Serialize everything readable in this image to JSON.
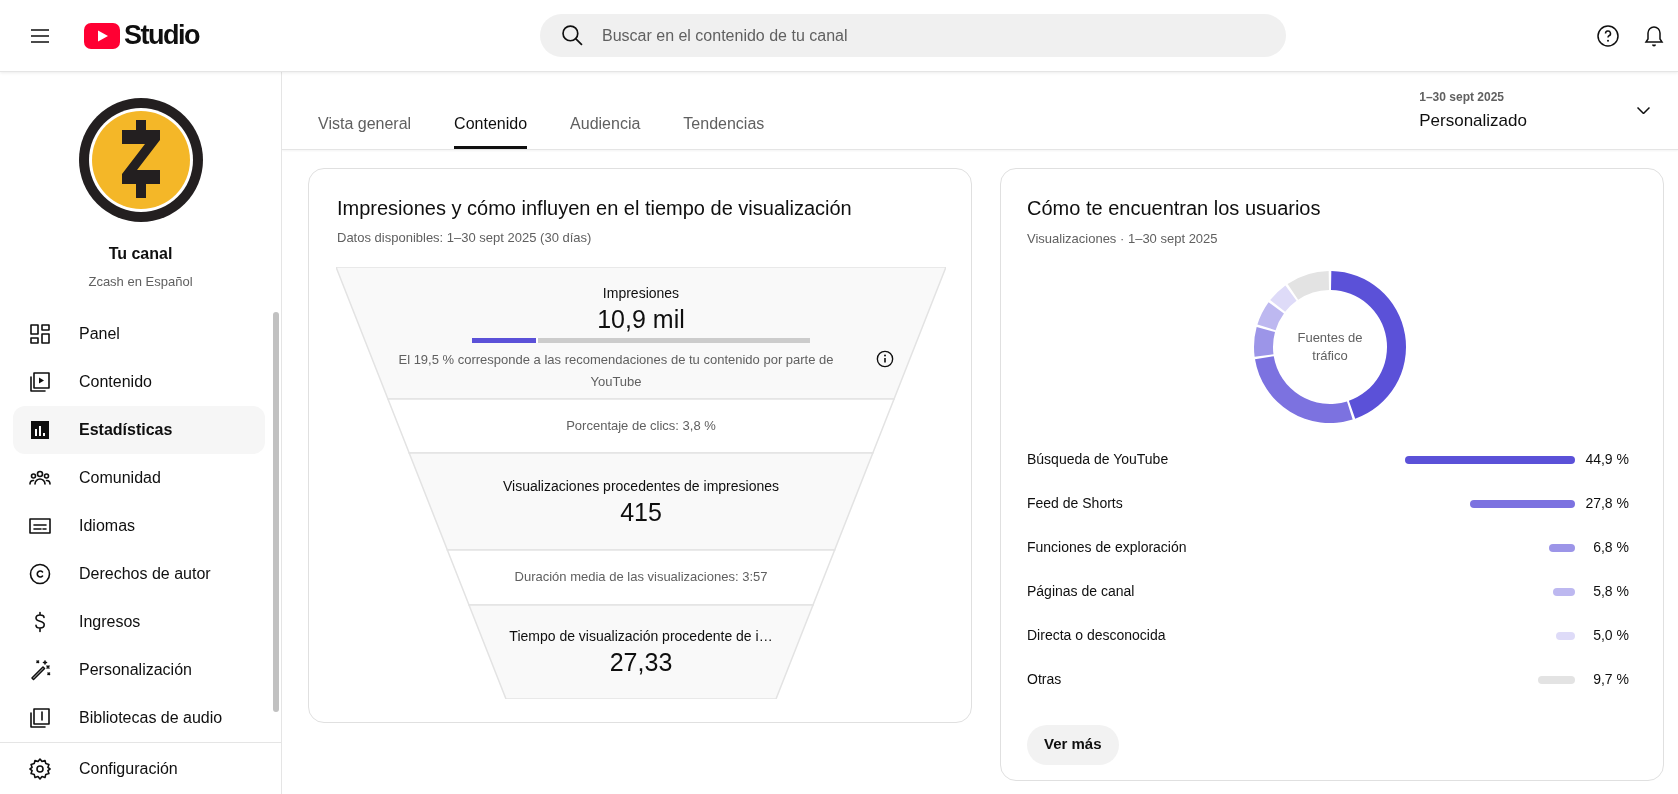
{
  "header": {
    "logo_text": "Studio",
    "search": {
      "placeholder": "Buscar en el contenido de tu canal"
    }
  },
  "channel": {
    "title": "Tu canal",
    "name": "Zcash en Español"
  },
  "sidebar": {
    "items": [
      {
        "label": "Panel",
        "selected": false
      },
      {
        "label": "Contenido",
        "selected": false
      },
      {
        "label": "Estadísticas",
        "selected": true
      },
      {
        "label": "Comunidad",
        "selected": false
      },
      {
        "label": "Idiomas",
        "selected": false
      },
      {
        "label": "Derechos de autor",
        "selected": false
      },
      {
        "label": "Ingresos",
        "selected": false
      },
      {
        "label": "Personalización",
        "selected": false
      },
      {
        "label": "Bibliotecas de audio",
        "selected": false
      }
    ],
    "footer_item": {
      "label": "Configuración"
    }
  },
  "tabs": [
    {
      "label": "Vista general",
      "selected": false
    },
    {
      "label": "Contenido",
      "selected": true
    },
    {
      "label": "Audiencia",
      "selected": false
    },
    {
      "label": "Tendencias",
      "selected": false
    }
  ],
  "date_range": {
    "range": "1–30 sept 2025",
    "preset": "Personalizado"
  },
  "impressions_card": {
    "title": "Impresiones y cómo influyen en el tiempo de visualización",
    "subtitle": "Datos disponibles: 1–30 sept 2025 (30 días)",
    "funnel": [
      {
        "kind": "metric",
        "label": "Impresiones",
        "value": "10,9 mil",
        "level": 0.195,
        "note": "El 19,5 % corresponde a las recomendaciones de tu contenido por parte de YouTube"
      },
      {
        "kind": "rate",
        "text": "Porcentaje de clics: 3,8 %"
      },
      {
        "kind": "metric",
        "label": "Visualizaciones procedentes de impresiones",
        "value": "415"
      },
      {
        "kind": "rate",
        "text": "Duración media de las visualizaciones: 3:57"
      },
      {
        "kind": "metric",
        "label": "Tiempo de visualización procedente de i…",
        "value": "27,33"
      }
    ]
  },
  "traffic_card": {
    "title": "Cómo te encuentran los usuarios",
    "subtitle": "Visualizaciones · 1–30 sept 2025",
    "chart_data": {
      "type": "donut",
      "title": "Fuentes de tráfico",
      "categories": [
        "Búsqueda de YouTube",
        "Feed de Shorts",
        "Funciones de exploración",
        "Páginas de canal",
        "Directa o desconocida",
        "Otras"
      ],
      "values": [
        44.9,
        27.8,
        6.8,
        5.8,
        5.0,
        9.7
      ]
    },
    "sources": [
      {
        "value": "44,9 %",
        "color": "#5b51d8"
      },
      {
        "value": "27,8 %",
        "color": "#7c72e0"
      },
      {
        "value": "6,8 %",
        "color": "#9c95e8"
      },
      {
        "value": "5,8 %",
        "color": "#bdb8f0"
      },
      {
        "value": "5,0 %",
        "color": "#dedbf8"
      },
      {
        "value": "9,7 %",
        "color": "#e3e3e3"
      }
    ],
    "more_button": "Ver más"
  }
}
